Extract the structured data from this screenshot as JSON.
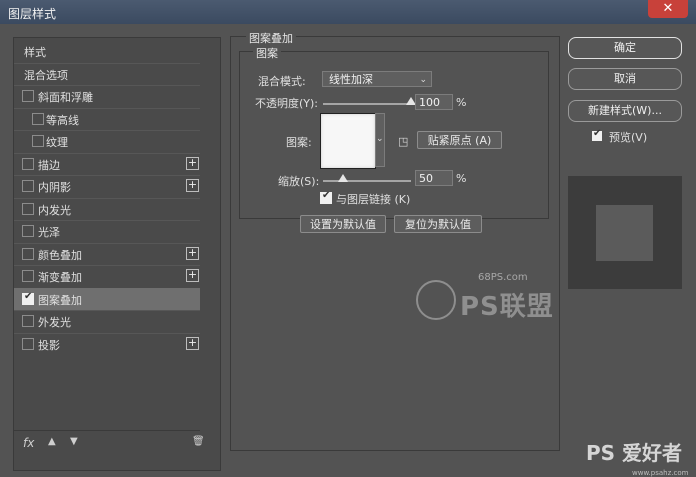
{
  "window": {
    "title": "图层样式",
    "close_label": "✕"
  },
  "left_panel": {
    "items": [
      {
        "label": "样式",
        "checkbox": false,
        "checked": false,
        "plus": false,
        "sub": false,
        "active": false
      },
      {
        "label": "混合选项",
        "checkbox": false,
        "checked": false,
        "plus": false,
        "sub": false,
        "active": false
      },
      {
        "label": "斜面和浮雕",
        "checkbox": true,
        "checked": false,
        "plus": false,
        "sub": false,
        "active": false
      },
      {
        "label": "等高线",
        "checkbox": true,
        "checked": false,
        "plus": false,
        "sub": true,
        "active": false
      },
      {
        "label": "纹理",
        "checkbox": true,
        "checked": false,
        "plus": false,
        "sub": true,
        "active": false
      },
      {
        "label": "描边",
        "checkbox": true,
        "checked": false,
        "plus": true,
        "sub": false,
        "active": false
      },
      {
        "label": "内阴影",
        "checkbox": true,
        "checked": false,
        "plus": true,
        "sub": false,
        "active": false
      },
      {
        "label": "内发光",
        "checkbox": true,
        "checked": false,
        "plus": false,
        "sub": false,
        "active": false
      },
      {
        "label": "光泽",
        "checkbox": true,
        "checked": false,
        "plus": false,
        "sub": false,
        "active": false
      },
      {
        "label": "颜色叠加",
        "checkbox": true,
        "checked": false,
        "plus": true,
        "sub": false,
        "active": false
      },
      {
        "label": "渐变叠加",
        "checkbox": true,
        "checked": false,
        "plus": true,
        "sub": false,
        "active": false
      },
      {
        "label": "图案叠加",
        "checkbox": true,
        "checked": true,
        "plus": false,
        "sub": false,
        "active": true
      },
      {
        "label": "外发光",
        "checkbox": true,
        "checked": false,
        "plus": false,
        "sub": false,
        "active": false
      },
      {
        "label": "投影",
        "checkbox": true,
        "checked": false,
        "plus": true,
        "sub": false,
        "active": false
      }
    ],
    "footer": {
      "fx": "fx",
      "up_icon": "▲",
      "down_icon": "▼",
      "trash_icon": "🗑"
    }
  },
  "pattern_overlay": {
    "group_title": "图案叠加",
    "sub_title": "图案",
    "blend_mode_label": "混合模式:",
    "blend_mode_value": "线性加深",
    "opacity_label": "不透明度(Y):",
    "opacity_value": "100",
    "opacity_fraction": 1.0,
    "percent": "%",
    "pattern_label": "图案:",
    "snap_button": "贴紧原点 (A)",
    "scale_label": "缩放(S):",
    "scale_value": "50",
    "scale_fraction": 0.5,
    "link_label": "与图层链接 (K)",
    "link_checked": true,
    "set_default": "设置为默认值",
    "reset_default": "复位为默认值"
  },
  "right_panel": {
    "ok": "确定",
    "cancel": "取消",
    "new_style": "新建样式(W)...",
    "preview_label": "预览(V)",
    "preview_checked": true
  },
  "watermark": {
    "site": "68PS.com",
    "logo_text": "PS联盟",
    "bottom_text": "PS 爱好者",
    "bottom_url": "www.psahz.com"
  }
}
